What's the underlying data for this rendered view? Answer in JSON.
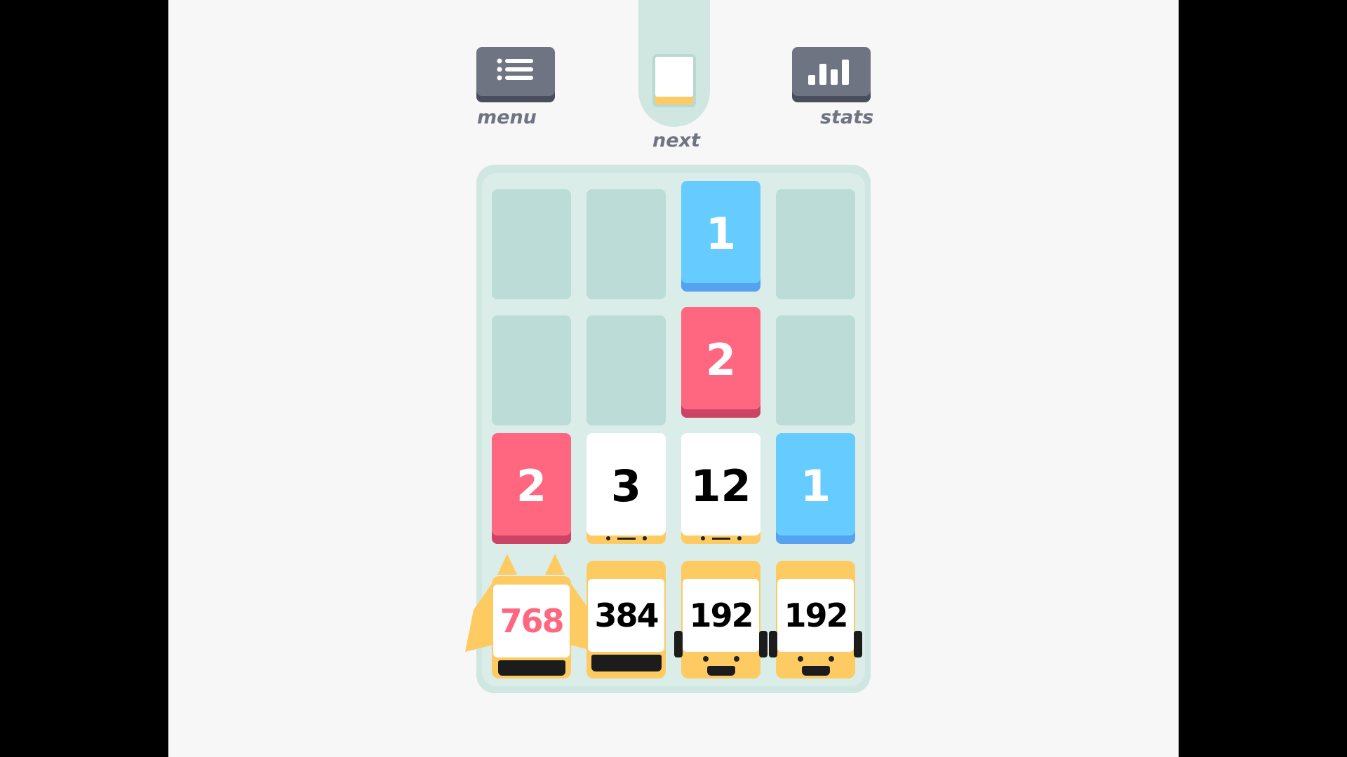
{
  "header": {
    "menu_label": "menu",
    "next_label": "next",
    "stats_label": "stats"
  },
  "next_tile": {
    "color": "white"
  },
  "icons": {
    "menu": "list-icon",
    "stats": "bar-chart-icon"
  },
  "colors": {
    "background": "#f7f7f7",
    "board": "#cfe6e1",
    "slot": "#bcdcd8",
    "blue": "#66ccff",
    "red": "#ff6680",
    "white": "#ffffff",
    "gold": "#fdcb62",
    "button": "#6f7482"
  },
  "board": {
    "rows": [
      [
        "",
        "",
        "1",
        ""
      ],
      [
        "",
        "",
        "2",
        ""
      ],
      [
        "2",
        "3",
        "12",
        "1"
      ],
      [
        "768",
        "384",
        "192",
        "192"
      ]
    ]
  }
}
